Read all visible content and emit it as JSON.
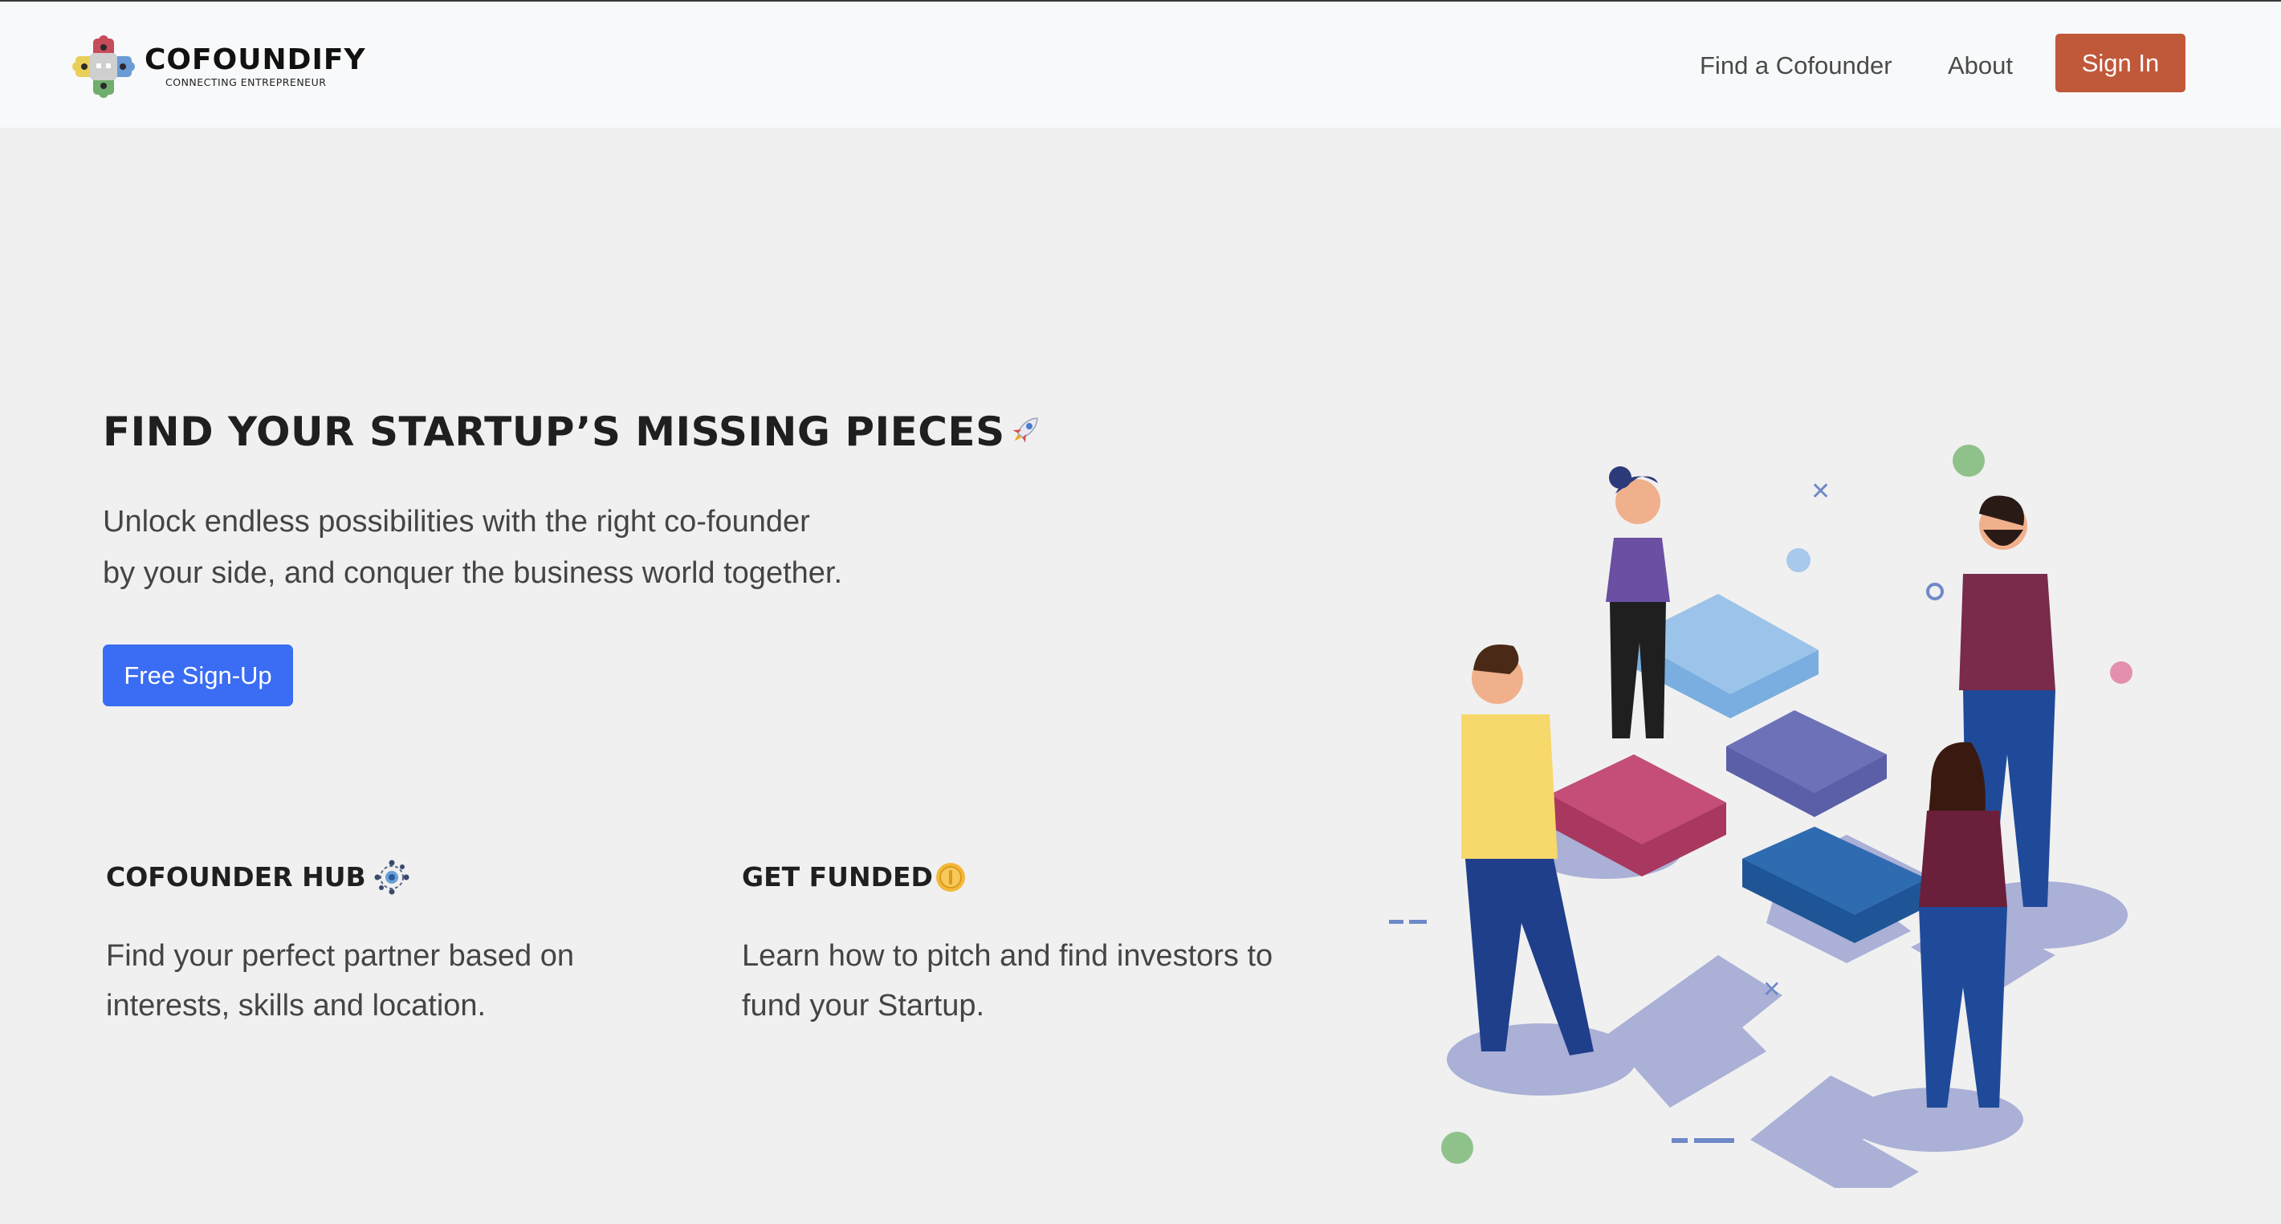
{
  "brand": {
    "name": "COFOUNDIFY",
    "tagline": "CONNECTING ENTREPRENEUR",
    "logo_icon": "puzzle-cross-logo"
  },
  "nav": {
    "links": [
      {
        "label": "Find a Cofounder"
      },
      {
        "label": "About"
      }
    ],
    "signin_label": "Sign In"
  },
  "hero": {
    "title": "FIND YOUR STARTUP’S MISSING PIECES",
    "title_icon": "rocket-icon",
    "subtitle_line1": "Unlock endless possibilities with the right co-founder",
    "subtitle_line2": "by your side, and conquer the business world together.",
    "cta_label": "Free Sign-Up"
  },
  "features": [
    {
      "title": "COFOUNDER HUB",
      "icon": "network-hub-icon",
      "description_line1": "Find your perfect partner based on",
      "description_line2": "interests, skills and location."
    },
    {
      "title": "GET FUNDED",
      "icon": "coin-icon",
      "description_line1": "Learn how to pitch and find investors to",
      "description_line2": "fund your Startup."
    }
  ],
  "illustration": {
    "icon": "team-puzzle-illustration"
  },
  "colors": {
    "page_bg": "#f0f0f0",
    "navbar_bg": "#f8f9fa",
    "signin_bg": "#c0583a",
    "cta_bg": "#3a6cf4"
  }
}
